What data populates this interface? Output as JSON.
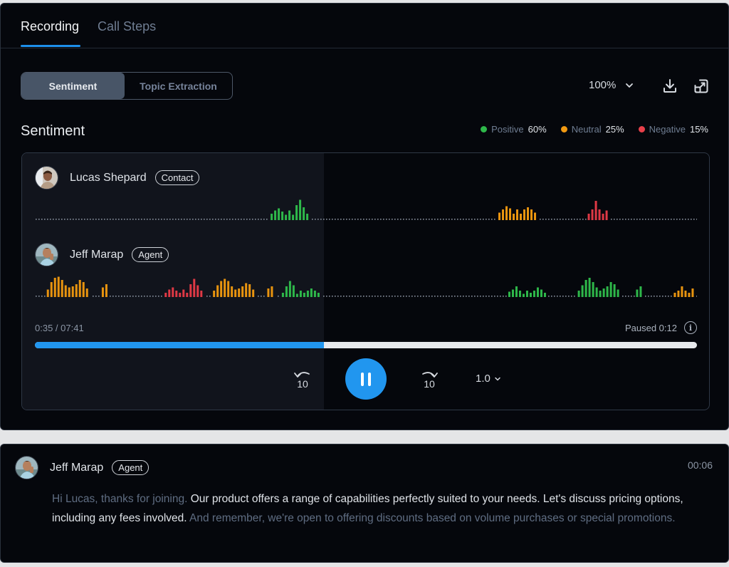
{
  "tabs": [
    {
      "label": "Recording",
      "active": true
    },
    {
      "label": "Call Steps",
      "active": false
    }
  ],
  "view_toggle": [
    {
      "label": "Sentiment",
      "active": true
    },
    {
      "label": "Topic Extraction",
      "active": false
    }
  ],
  "toolbar": {
    "zoom_level": "100%",
    "download_icon": "download-icon",
    "expand_icon": "expand-icon"
  },
  "sentiment": {
    "title": "Sentiment",
    "legend": [
      {
        "label": "Positive",
        "value": "60%",
        "color": "#2eb84a"
      },
      {
        "label": "Neutral",
        "value": "25%",
        "color": "#f29a12"
      },
      {
        "label": "Negative",
        "value": "15%",
        "color": "#e8404a"
      }
    ]
  },
  "colors": {
    "positive": "#2eb84a",
    "neutral": "#e8940f",
    "negative": "#df3945",
    "accent": "#2196ef"
  },
  "speakers": [
    {
      "name": "Lucas Shepard",
      "role": "Contact",
      "segments": [
        {
          "start": 0.356,
          "sentiment": "positive",
          "levels": [
            0.3,
            0.45,
            0.55,
            0.4,
            0.25,
            0.45,
            0.25,
            0.7,
            0.95,
            0.6,
            0.3
          ]
        },
        {
          "start": 0.7,
          "sentiment": "neutral",
          "levels": [
            0.35,
            0.5,
            0.65,
            0.55,
            0.3,
            0.5,
            0.3,
            0.5,
            0.6,
            0.5,
            0.35
          ]
        },
        {
          "start": 0.835,
          "sentiment": "negative",
          "levels": [
            0.3,
            0.5,
            0.9,
            0.5,
            0.3,
            0.45
          ]
        }
      ]
    },
    {
      "name": "Jeff Marap",
      "role": "Agent",
      "segments": [
        {
          "start": 0.018,
          "sentiment": "neutral",
          "levels": [
            0.35,
            0.7,
            0.9,
            0.95,
            0.8,
            0.55,
            0.45,
            0.5,
            0.6,
            0.8,
            0.7,
            0.4
          ]
        },
        {
          "start": 0.101,
          "sentiment": "neutral",
          "levels": [
            0.45,
            0.6
          ]
        },
        {
          "start": 0.196,
          "sentiment": "negative",
          "levels": [
            0.2,
            0.35,
            0.45,
            0.3,
            0.2,
            0.35,
            0.2,
            0.6,
            0.85,
            0.55,
            0.3
          ]
        },
        {
          "start": 0.269,
          "sentiment": "neutral",
          "levels": [
            0.3,
            0.55,
            0.75,
            0.85,
            0.75,
            0.5,
            0.35,
            0.4,
            0.5,
            0.65,
            0.6,
            0.35
          ]
        },
        {
          "start": 0.351,
          "sentiment": "neutral",
          "levels": [
            0.4,
            0.5
          ]
        },
        {
          "start": 0.373,
          "sentiment": "positive",
          "levels": [
            0.2,
            0.5,
            0.75,
            0.55,
            0.15,
            0.3,
            0.2,
            0.3,
            0.4,
            0.3,
            0.2
          ]
        },
        {
          "start": 0.715,
          "sentiment": "positive",
          "levels": [
            0.25,
            0.35,
            0.5,
            0.3,
            0.15,
            0.3,
            0.2,
            0.3,
            0.45,
            0.35,
            0.2
          ]
        },
        {
          "start": 0.82,
          "sentiment": "positive",
          "levels": [
            0.3,
            0.55,
            0.8,
            0.9,
            0.7,
            0.45,
            0.3,
            0.4,
            0.5,
            0.7,
            0.6,
            0.35
          ]
        },
        {
          "start": 0.908,
          "sentiment": "positive",
          "levels": [
            0.35,
            0.5
          ]
        },
        {
          "start": 0.965,
          "sentiment": "neutral",
          "levels": [
            0.2,
            0.3,
            0.5,
            0.3,
            0.2,
            0.4
          ]
        }
      ]
    }
  ],
  "player": {
    "current_time": "0:35 / 07:41",
    "paused_label": "Paused 0:12",
    "progress": 0.437,
    "skip_back": "10",
    "skip_forward": "10",
    "speed": "1.0"
  },
  "transcript": {
    "speaker": "Jeff Marap",
    "role": "Agent",
    "timestamp": "00:06",
    "segments": [
      {
        "text": "Hi Lucas, thanks for joining. ",
        "highlight": false
      },
      {
        "text": "Our product offers a range of capabilities perfectly suited to your needs. Let's discuss pricing options, including any fees involved. ",
        "highlight": true
      },
      {
        "text": "And remember, we're open to offering discounts based on volume purchases or special promotions.",
        "highlight": false
      }
    ]
  }
}
